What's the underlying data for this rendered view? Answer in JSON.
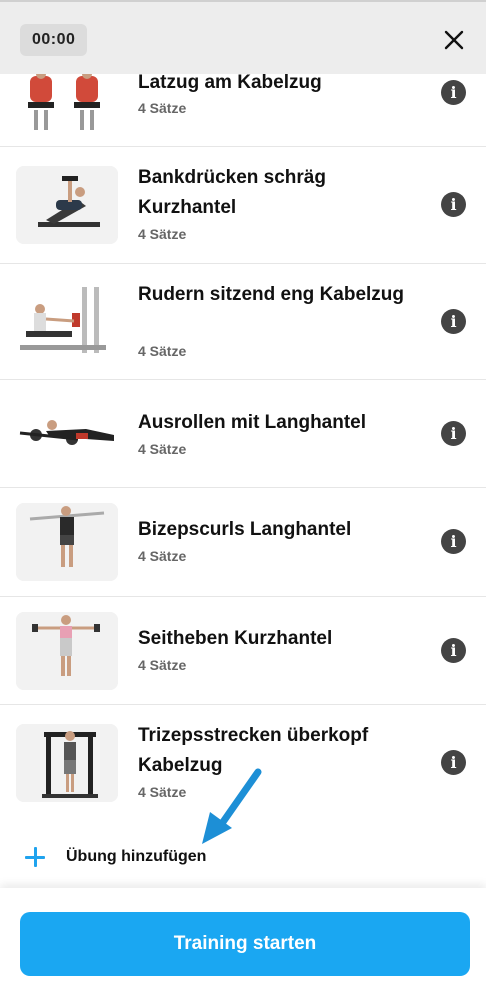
{
  "header": {
    "timer": "00:00",
    "close_icon": "close-icon"
  },
  "exercises": [
    {
      "title": "Latzug am Kabelzug",
      "sets": "4 Sätze",
      "info_icon": "info-icon"
    },
    {
      "title": "Bankdrücken schräg Kurzhantel",
      "sets": "4 Sätze",
      "info_icon": "info-icon"
    },
    {
      "title": "Rudern sitzend eng Kabelzug",
      "sets": "4 Sätze",
      "info_icon": "info-icon"
    },
    {
      "title": "Ausrollen mit Langhantel",
      "sets": "4 Sätze",
      "info_icon": "info-icon"
    },
    {
      "title": "Bizepscurls Langhantel",
      "sets": "4 Sätze",
      "info_icon": "info-icon"
    },
    {
      "title": "Seitheben Kurzhantel",
      "sets": "4 Sätze",
      "info_icon": "info-icon"
    },
    {
      "title": "Trizepsstrecken überkopf Kabelzug",
      "sets": "4 Sätze",
      "info_icon": "info-icon"
    }
  ],
  "add_exercise": {
    "label": "Übung hinzufügen",
    "icon": "plus-icon"
  },
  "footer": {
    "start_label": "Training starten"
  },
  "colors": {
    "accent": "#1aa7f2",
    "plus": "#1fa3ee",
    "header_bg": "#ededed"
  }
}
